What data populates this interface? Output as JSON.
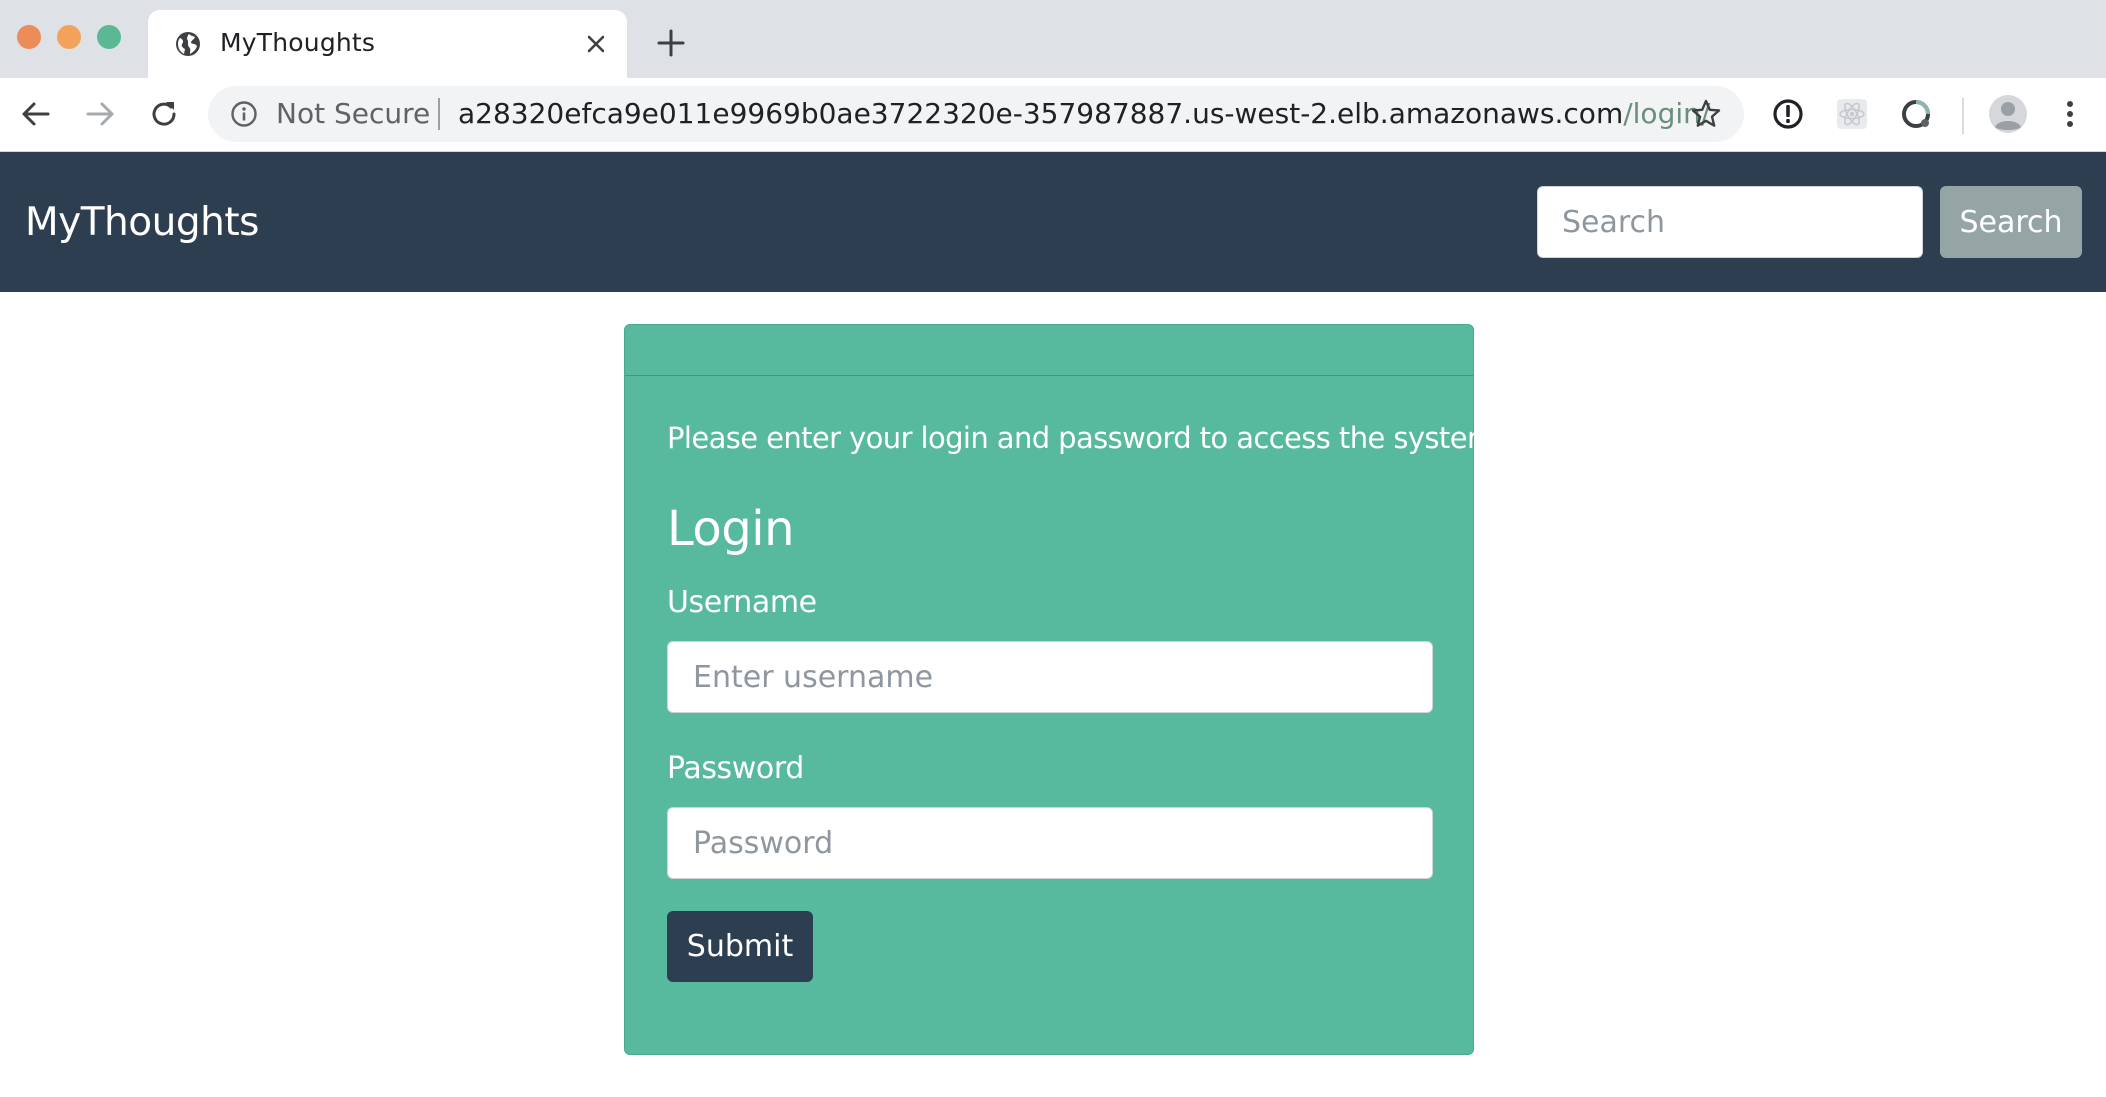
{
  "browser": {
    "tab": {
      "title": "MyThoughts"
    },
    "address_bar": {
      "security_label": "Not Secure",
      "url_host": "a28320efca9e011e9969b0ae3722320e-357987887.us-west-2.elb.amazonaws.com",
      "url_path": "/login/"
    },
    "icons": {
      "favicon": "globe-icon",
      "tab_close": "close-icon",
      "new_tab": "plus-icon",
      "back": "back-arrow-icon",
      "forward": "forward-arrow-icon",
      "reload": "reload-icon",
      "site_info": "info-icon",
      "bookmark": "star-icon",
      "extension_1": "password-manager-icon",
      "extension_2": "react-devtools-icon",
      "extension_3": "extension-icon",
      "profile": "avatar-icon",
      "menu": "kebab-menu-icon"
    }
  },
  "navbar": {
    "brand": "MyThoughts",
    "search": {
      "placeholder": "Search",
      "button_label": "Search"
    }
  },
  "login_card": {
    "intro": "Please enter your login and password to access the system.",
    "heading": "Login",
    "username": {
      "label": "Username",
      "placeholder": "Enter username"
    },
    "password": {
      "label": "Password",
      "placeholder": "Password"
    },
    "submit_label": "Submit"
  },
  "colors": {
    "navbar_bg": "#2c3e50",
    "card_bg": "#57b99d",
    "search_button_bg": "#95a5a6",
    "submit_button_bg": "#2c3e50"
  }
}
